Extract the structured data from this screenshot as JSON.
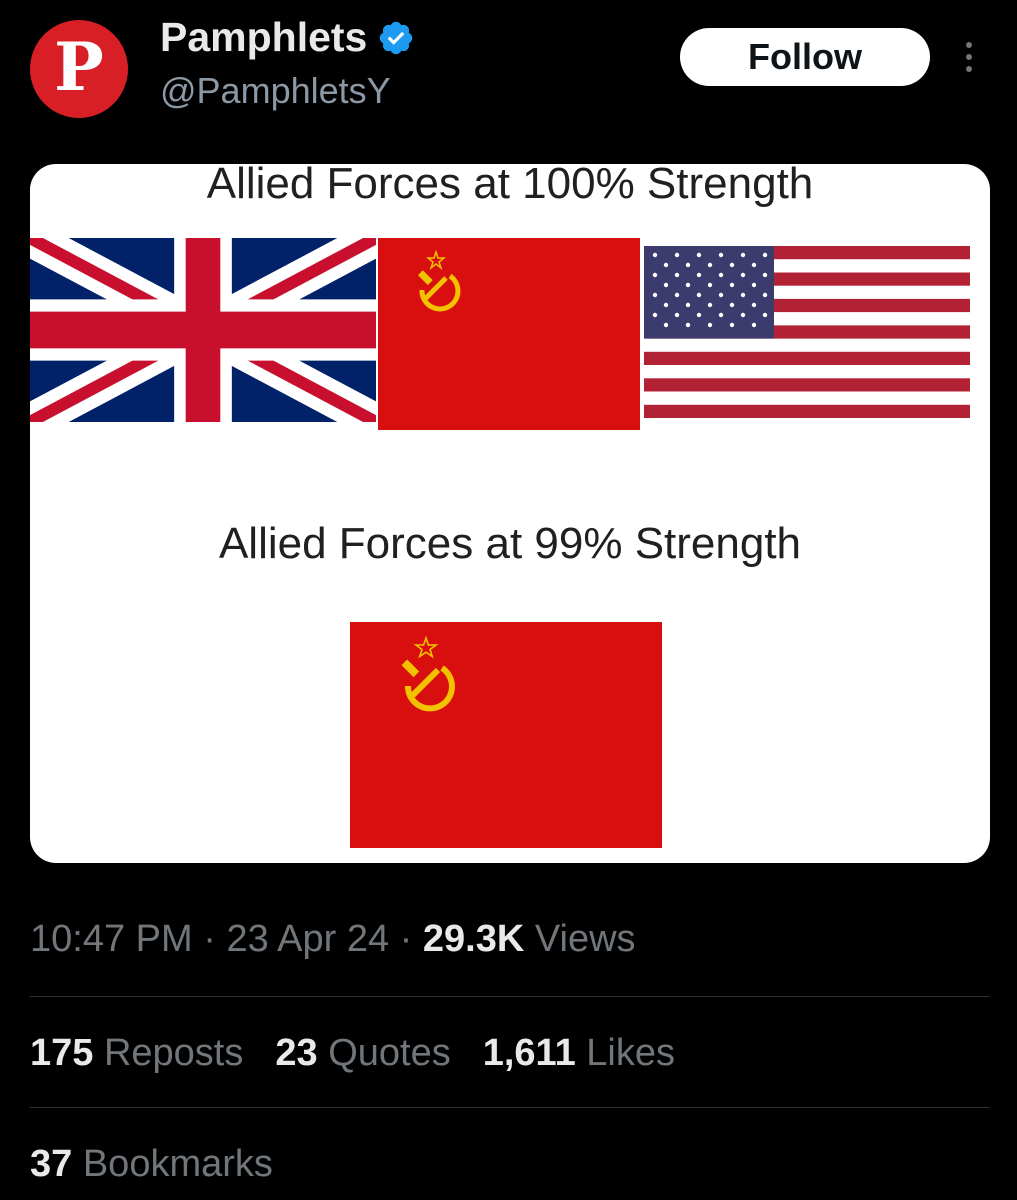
{
  "author": {
    "avatar_letter": "P",
    "display_name": "Pamphlets",
    "handle": "@PamphletsY",
    "verified": true,
    "avatar_color": "#d81f26",
    "verified_color": "#1d9bf0"
  },
  "actions": {
    "follow_label": "Follow",
    "more_icon": "more-vertical-icon"
  },
  "media": {
    "caption_top": "Allied Forces at 100% Strength",
    "caption_bottom": "Allied Forces at 99% Strength",
    "flags_top": [
      "uk-flag",
      "soviet-flag",
      "us-flag"
    ],
    "flags_bottom": [
      "soviet-flag"
    ]
  },
  "meta": {
    "time": "10:47 PM",
    "sep1": " · ",
    "date": "23 Apr 24",
    "sep2": " · ",
    "views_count": "29.3K",
    "views_label": " Views"
  },
  "stats": [
    {
      "count": "175",
      "label": " Reposts"
    },
    {
      "count": "23",
      "label": " Quotes"
    },
    {
      "count": "1,611",
      "label": " Likes"
    }
  ],
  "bookmarks": {
    "count": "37",
    "label": " Bookmarks"
  }
}
